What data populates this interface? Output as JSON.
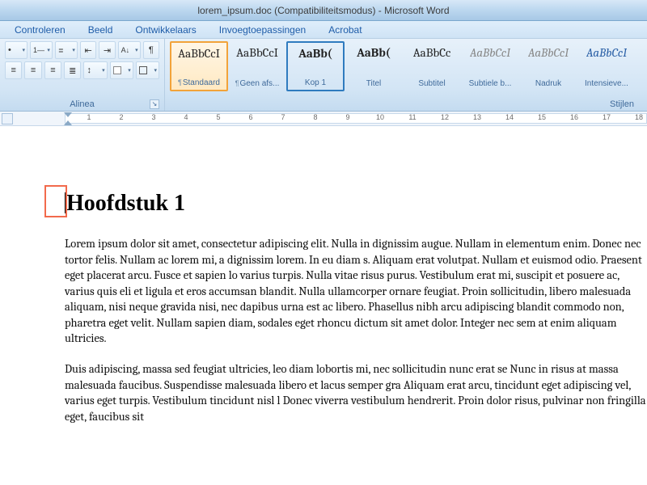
{
  "window": {
    "title": "lorem_ipsum.doc (Compatibiliteitsmodus) - Microsoft Word"
  },
  "tabs": {
    "controleren": "Controleren",
    "beeld": "Beeld",
    "ontwikkelaars": "Ontwikkelaars",
    "invoegtoepassingen": "Invoegtoepassingen",
    "acrobat": "Acrobat"
  },
  "ribbon": {
    "alinea_label": "Alinea",
    "stijlen_label": "Stijlen",
    "styles": [
      {
        "sample": "AaBbCcI",
        "label": "¶ Standaard",
        "variant": "serif",
        "selected": "orange",
        "pil": true
      },
      {
        "sample": "AaBbCcI",
        "label": "Geen afs...",
        "variant": "serif",
        "selected": "",
        "pil": true
      },
      {
        "sample": "AaBb(",
        "label": "Kop 1",
        "variant": "serifbold",
        "selected": "blue",
        "pil": false
      },
      {
        "sample": "AaBb(",
        "label": "Titel",
        "variant": "serifbold",
        "selected": "",
        "pil": false
      },
      {
        "sample": "AaBbCc",
        "label": "Subtitel",
        "variant": "serif",
        "selected": "",
        "pil": false
      },
      {
        "sample": "AaBbCcI",
        "label": "Subtiele b...",
        "variant": "italicgray",
        "selected": "",
        "pil": false
      },
      {
        "sample": "AaBbCcI",
        "label": "Nadruk",
        "variant": "italicgray",
        "selected": "",
        "pil": false
      },
      {
        "sample": "AaBbCcI",
        "label": "Intensieve...",
        "variant": "italicblue",
        "selected": "",
        "pil": false
      }
    ]
  },
  "ruler": {
    "numbers": [
      "",
      "1",
      "",
      "2",
      "",
      "3",
      "",
      "4",
      "",
      "5",
      "",
      "6",
      "",
      "7",
      "",
      "8",
      "",
      "9",
      "",
      "10",
      "",
      "11",
      "",
      "12",
      "",
      "13",
      "",
      "14",
      "",
      "15",
      "",
      "16",
      "",
      "17",
      "",
      "18"
    ]
  },
  "document": {
    "heading": "Hoofdstuk 1",
    "para1": "Lorem ipsum dolor sit amet, consectetur adipiscing elit. Nulla in dignissim augue. Nullam in elementum enim. Donec nec tortor felis. Nullam ac lorem mi, a dignissim lorem. In eu diam s. Aliquam erat volutpat. Nullam et euismod odio. Praesent eget placerat arcu. Fusce et sapien lo varius turpis. Nulla vitae risus purus. Vestibulum erat mi, suscipit et posuere ac, varius quis eli et ligula et eros accumsan blandit. Nulla ullamcorper ornare feugiat. Proin sollicitudin, libero malesuada aliquam, nisi neque gravida nisi, nec dapibus urna est ac libero. Phasellus nibh arcu adipiscing blandit commodo non, pharetra eget velit. Nullam sapien diam, sodales eget rhoncu dictum sit amet dolor. Integer nec sem at enim aliquam ultricies.",
    "para2": "Duis adipiscing, massa sed feugiat ultricies, leo diam lobortis mi, nec sollicitudin nunc erat se Nunc in risus at massa malesuada faucibus. Suspendisse malesuada libero et lacus semper gra Aliquam erat arcu, tincidunt eget adipiscing vel, varius eget turpis. Vestibulum tincidunt nisl l Donec viverra vestibulum hendrerit. Proin dolor risus, pulvinar non fringilla eget, faucibus sit"
  }
}
